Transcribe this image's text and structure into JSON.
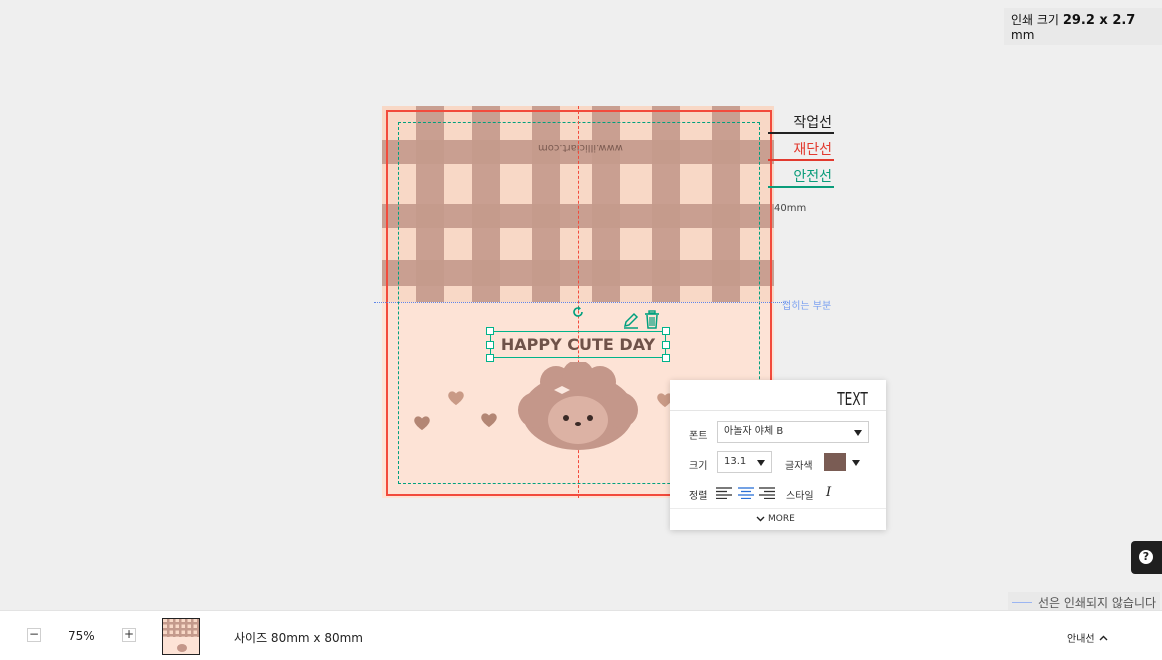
{
  "print_size": {
    "label": "인쇄 크기",
    "value": "29.2 x 2.7",
    "unit": "mm"
  },
  "canvas": {
    "watermark": "www.illiciart.com",
    "dimension_label": "40mm",
    "fold_label": "접히는 부분",
    "text_element": {
      "text": "HAPPY CUTE DAY"
    }
  },
  "legend": {
    "work_line": "작업선",
    "cut_line": "재단선",
    "safe_line": "안전선"
  },
  "text_panel": {
    "title": "TEXT",
    "font_label": "폰트",
    "font_value": "아놀자 야체 B",
    "size_label": "크기",
    "size_value": "13.1",
    "color_label": "글자색",
    "color_value": "#7a5c54",
    "align_label": "정렬",
    "style_label": "스타일",
    "more_label": "MORE"
  },
  "help_icon": "question-icon",
  "no_print_note": "선은 인쇄되지 않습니다",
  "bottom_bar": {
    "zoom_out": "−",
    "zoom_level": "75%",
    "zoom_in": "+",
    "size_text": "사이즈 80mm x 80mm",
    "guide_label": "안내선"
  }
}
